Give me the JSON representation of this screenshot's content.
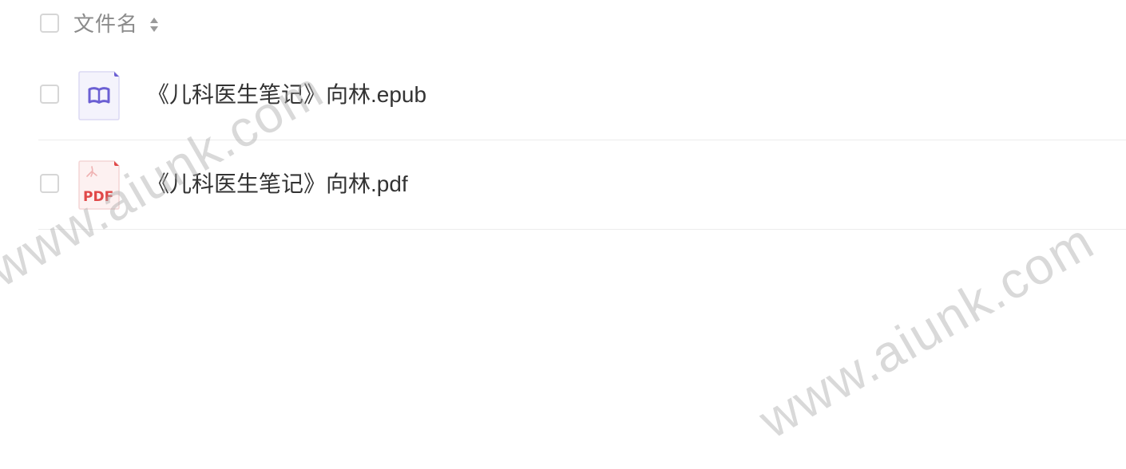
{
  "header": {
    "column_label": "文件名",
    "sort_icon": "sort-updown-icon"
  },
  "files": [
    {
      "name": "《儿科医生笔记》向林.epub",
      "icon": "epub-book-icon",
      "accent": "#6b5fd3"
    },
    {
      "name": "《儿科医生笔记》向林.pdf",
      "icon": "pdf-file-icon",
      "accent": "#e04848",
      "icon_text": "PDF"
    }
  ],
  "watermark": "www.aiunk.com",
  "colors": {
    "text": "#333333",
    "header_text": "#8b8b8b",
    "border": "#ececec",
    "checkbox_border": "#d6d6d6"
  }
}
